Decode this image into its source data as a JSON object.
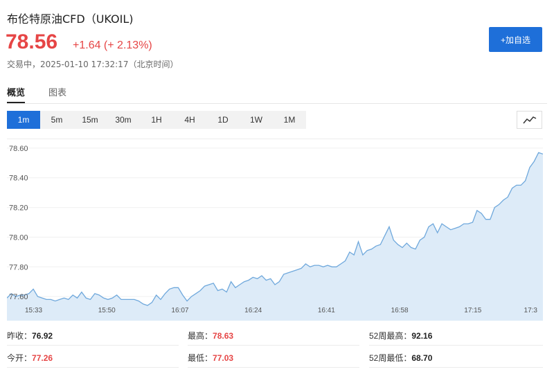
{
  "header": {
    "title": "布伦特原油CFD（UKOIL)",
    "price": "78.56",
    "change": "+1.64 (+ 2.13%)",
    "status": "交易中，2025-01-10 17:32:17（北京时间）",
    "watch_button": "+加自选"
  },
  "tabs": [
    {
      "label": "概览",
      "active": true
    },
    {
      "label": "图表",
      "active": false
    }
  ],
  "periods": [
    "1m",
    "5m",
    "15m",
    "30m",
    "1H",
    "4H",
    "1D",
    "1W",
    "1M"
  ],
  "active_period": "1m",
  "chart_type_icon": "line-chart-icon",
  "colors": {
    "up": "#e64545",
    "accent": "#1e6fd9",
    "line": "#6fa8dc",
    "fill": "#ddebf8"
  },
  "chart_data": {
    "type": "area",
    "ylim": [
      77.54,
      78.66
    ],
    "yticks": [
      "78.60",
      "78.40",
      "78.20",
      "78.00",
      "77.80",
      "77.60"
    ],
    "xticks": [
      "15:33",
      "15:50",
      "16:07",
      "16:24",
      "16:41",
      "16:58",
      "17:15",
      "17:3"
    ],
    "values": [
      77.59,
      77.62,
      77.6,
      77.61,
      77.61,
      77.62,
      77.65,
      77.6,
      77.59,
      77.58,
      77.58,
      77.57,
      77.58,
      77.59,
      77.58,
      77.61,
      77.59,
      77.63,
      77.59,
      77.58,
      77.62,
      77.61,
      77.59,
      77.58,
      77.59,
      77.61,
      77.58,
      77.58,
      77.58,
      77.58,
      77.57,
      77.55,
      77.54,
      77.56,
      77.61,
      77.58,
      77.62,
      77.65,
      77.66,
      77.66,
      77.61,
      77.57,
      77.6,
      77.62,
      77.64,
      77.67,
      77.68,
      77.69,
      77.64,
      77.65,
      77.63,
      77.7,
      77.66,
      77.68,
      77.7,
      77.71,
      77.73,
      77.72,
      77.74,
      77.71,
      77.72,
      77.68,
      77.7,
      77.75,
      77.76,
      77.77,
      77.78,
      77.79,
      77.82,
      77.8,
      77.81,
      77.81,
      77.8,
      77.81,
      77.8,
      77.8,
      77.82,
      77.84,
      77.9,
      77.88,
      77.97,
      77.88,
      77.91,
      77.92,
      77.94,
      77.95,
      78.01,
      78.07,
      77.98,
      77.95,
      77.93,
      77.96,
      77.93,
      77.92,
      77.98,
      78.0,
      78.07,
      78.09,
      78.03,
      78.09,
      78.07,
      78.05,
      78.06,
      78.07,
      78.09,
      78.09,
      78.1,
      78.18,
      78.16,
      78.12,
      78.12,
      78.2,
      78.22,
      78.25,
      78.27,
      78.33,
      78.35,
      78.35,
      78.38,
      78.47,
      78.51,
      78.57,
      78.56
    ]
  },
  "stats": [
    {
      "label": "昨收：",
      "value": "76.92",
      "color": "#222222"
    },
    {
      "label": "最高：",
      "value": "78.63",
      "color": "#e64545"
    },
    {
      "label": "52周最高：",
      "value": "92.16",
      "color": "#222222"
    },
    {
      "label": "今开：",
      "value": "77.26",
      "color": "#e64545"
    },
    {
      "label": "最低：",
      "value": "77.03",
      "color": "#e64545"
    },
    {
      "label": "52周最低：",
      "value": "68.70",
      "color": "#222222"
    }
  ]
}
